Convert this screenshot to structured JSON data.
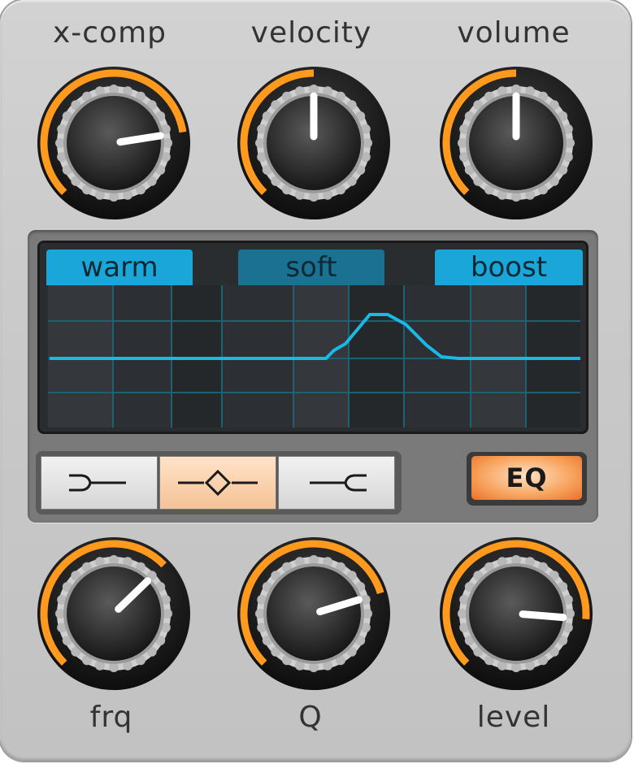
{
  "colors": {
    "accent_orange": "#ff9a1f",
    "screen_cyan": "#1ab8e6",
    "tab_active": "#1aa6d8",
    "tab_inactive": "#1b7192"
  },
  "knobs_top": [
    {
      "label": "x-comp",
      "value": 0.8,
      "arc_color": "#ff9a1f"
    },
    {
      "label": "velocity",
      "value": 0.5,
      "arc_color": "#ff9a1f"
    },
    {
      "label": "volume",
      "value": 0.5,
      "arc_color": "#ff9a1f"
    }
  ],
  "knobs_bottom": [
    {
      "label": "frq",
      "value": 0.67,
      "arc_color": "#ff9a1f"
    },
    {
      "label": "Q",
      "value": 0.77,
      "arc_color": "#ff9a1f"
    },
    {
      "label": "level",
      "value": 0.85,
      "arc_color": "#ff9a1f"
    }
  ],
  "presets": [
    {
      "label": "warm",
      "active": true
    },
    {
      "label": "soft",
      "active": false
    },
    {
      "label": "boost",
      "active": true
    }
  ],
  "filter_modes": [
    {
      "icon": "low-cut-icon",
      "active": false
    },
    {
      "icon": "bell-icon",
      "active": true
    },
    {
      "icon": "high-cut-icon",
      "active": false
    }
  ],
  "eq_button": {
    "label": "EQ",
    "active": true
  }
}
